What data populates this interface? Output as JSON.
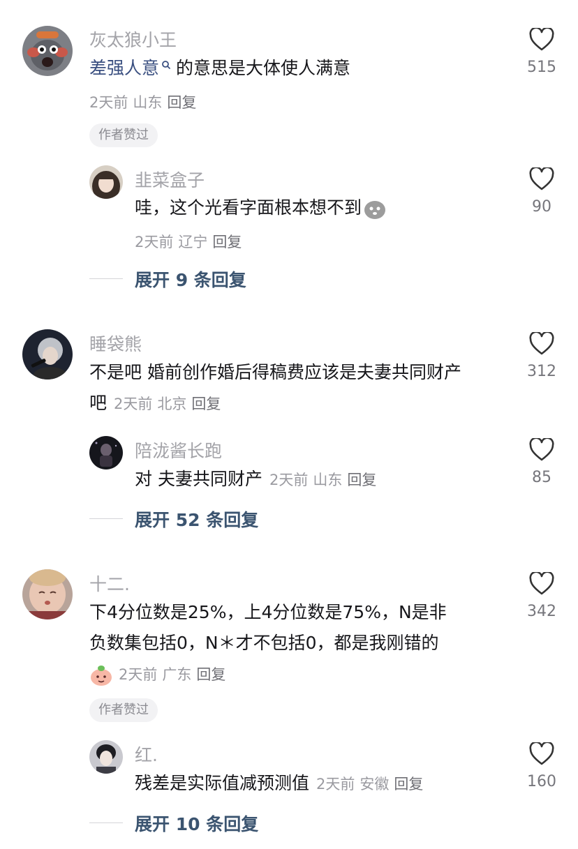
{
  "comments": [
    {
      "username": "灰太狼小王",
      "text_link": "差强人意",
      "text": "的意思是大体使人满意",
      "meta": {
        "time": "2天前",
        "location": "山东",
        "reply": "回复"
      },
      "likes": "515",
      "badge": "作者赞过",
      "subreply": {
        "username": "韭菜盒子",
        "text": "哇，这个光看字面根本想不到",
        "meta": {
          "time": "2天前",
          "location": "辽宁",
          "reply": "回复"
        },
        "likes": "90"
      },
      "expand": "展开 9 条回复"
    },
    {
      "username": "睡袋熊",
      "text_line1": "不是吧 婚前创作婚后得稿费应该是夫妻共同财产",
      "text_line2": "吧",
      "meta": {
        "time": "2天前",
        "location": "北京",
        "reply": "回复"
      },
      "likes": "312",
      "subreply": {
        "username": "陪泷酱长跑",
        "text": "对 夫妻共同财产",
        "meta": {
          "time": "2天前",
          "location": "山东",
          "reply": "回复"
        },
        "likes": "85"
      },
      "expand": "展开 52 条回复"
    },
    {
      "username": "十二.",
      "text_line1": "下4分位数是25%，上4分位数是75%，N是非",
      "text_line2": "负数集包括0，N＊才不包括0，都是我刚错的",
      "meta": {
        "time": "2天前",
        "location": "广东",
        "reply": "回复"
      },
      "likes": "342",
      "badge": "作者赞过",
      "subreply": {
        "username": "红.",
        "text": "残差是实际值减预测值",
        "meta": {
          "time": "2天前",
          "location": "安徽",
          "reply": "回复"
        },
        "likes": "160"
      },
      "expand": "展开 10 条回复"
    }
  ],
  "icons": {
    "like": "heart-outline-icon",
    "search": "search-icon",
    "emoji": "emoji-icon"
  },
  "colors": {
    "username": "#a3a3a8",
    "link": "#3a4f80",
    "expand": "#3b5470"
  }
}
